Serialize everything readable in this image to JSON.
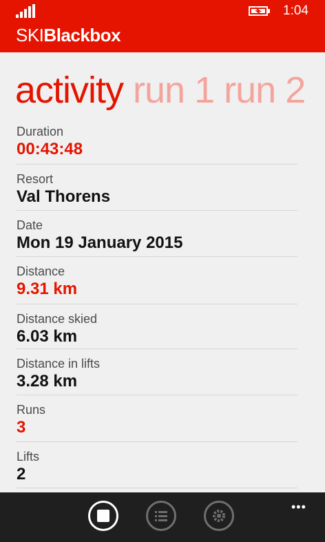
{
  "status_bar": {
    "time": "1:04"
  },
  "app": {
    "brand_light": "SKI",
    "brand_bold": "Blackbox"
  },
  "pivot": {
    "active": "activity",
    "tabs": [
      "run 1",
      "run 2"
    ]
  },
  "stats": [
    {
      "label": "Duration",
      "value": "00:43:48",
      "highlight": true
    },
    {
      "label": "Resort",
      "value": "Val Thorens",
      "highlight": false
    },
    {
      "label": "Date",
      "value": "Mon 19 January 2015",
      "highlight": false
    },
    {
      "label": "Distance",
      "value": "9.31 km",
      "highlight": true
    },
    {
      "label": "Distance skied",
      "value": "6.03 km",
      "highlight": false
    },
    {
      "label": "Distance in lifts",
      "value": "3.28 km",
      "highlight": false
    },
    {
      "label": "Runs",
      "value": "3",
      "highlight": true
    },
    {
      "label": "Lifts",
      "value": "2",
      "highlight": false
    }
  ],
  "appbar": {
    "buttons": [
      "stop-icon",
      "list-icon",
      "settings-icon"
    ],
    "more": "•••"
  },
  "colors": {
    "accent": "#e51400",
    "inactive_pivot": "#f3a59d"
  }
}
